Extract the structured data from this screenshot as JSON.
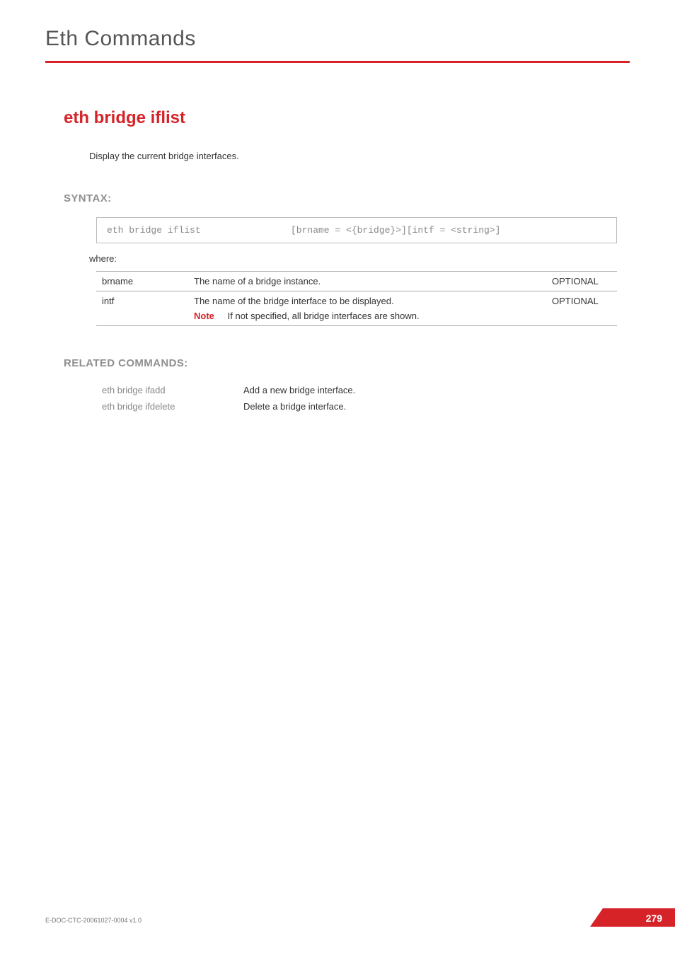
{
  "running_head": "Eth Commands",
  "command_title": "eth bridge iflist",
  "description": "Display the current bridge interfaces.",
  "syntax_heading": "SYNTAX:",
  "syntax": {
    "cmd": "eth bridge iflist",
    "args": "[brname = <{bridge}>][intf = <string>]"
  },
  "where_label": "where:",
  "params": [
    {
      "name": "brname",
      "desc": "The name of  a bridge instance.",
      "opt": "OPTIONAL",
      "note": null
    },
    {
      "name": "intf",
      "desc": "The name of the bridge interface to be displayed.",
      "opt": "OPTIONAL",
      "note": {
        "label": "Note",
        "text": "If not specified, all bridge interfaces are shown."
      }
    }
  ],
  "related_heading": "RELATED COMMANDS:",
  "related": [
    {
      "name": "eth bridge ifadd",
      "desc": "Add a new bridge interface."
    },
    {
      "name": "eth bridge ifdelete",
      "desc": "Delete a bridge interface."
    }
  ],
  "footer": {
    "docid": "E-DOC-CTC-20061027-0004 v1.0",
    "page": "279"
  }
}
